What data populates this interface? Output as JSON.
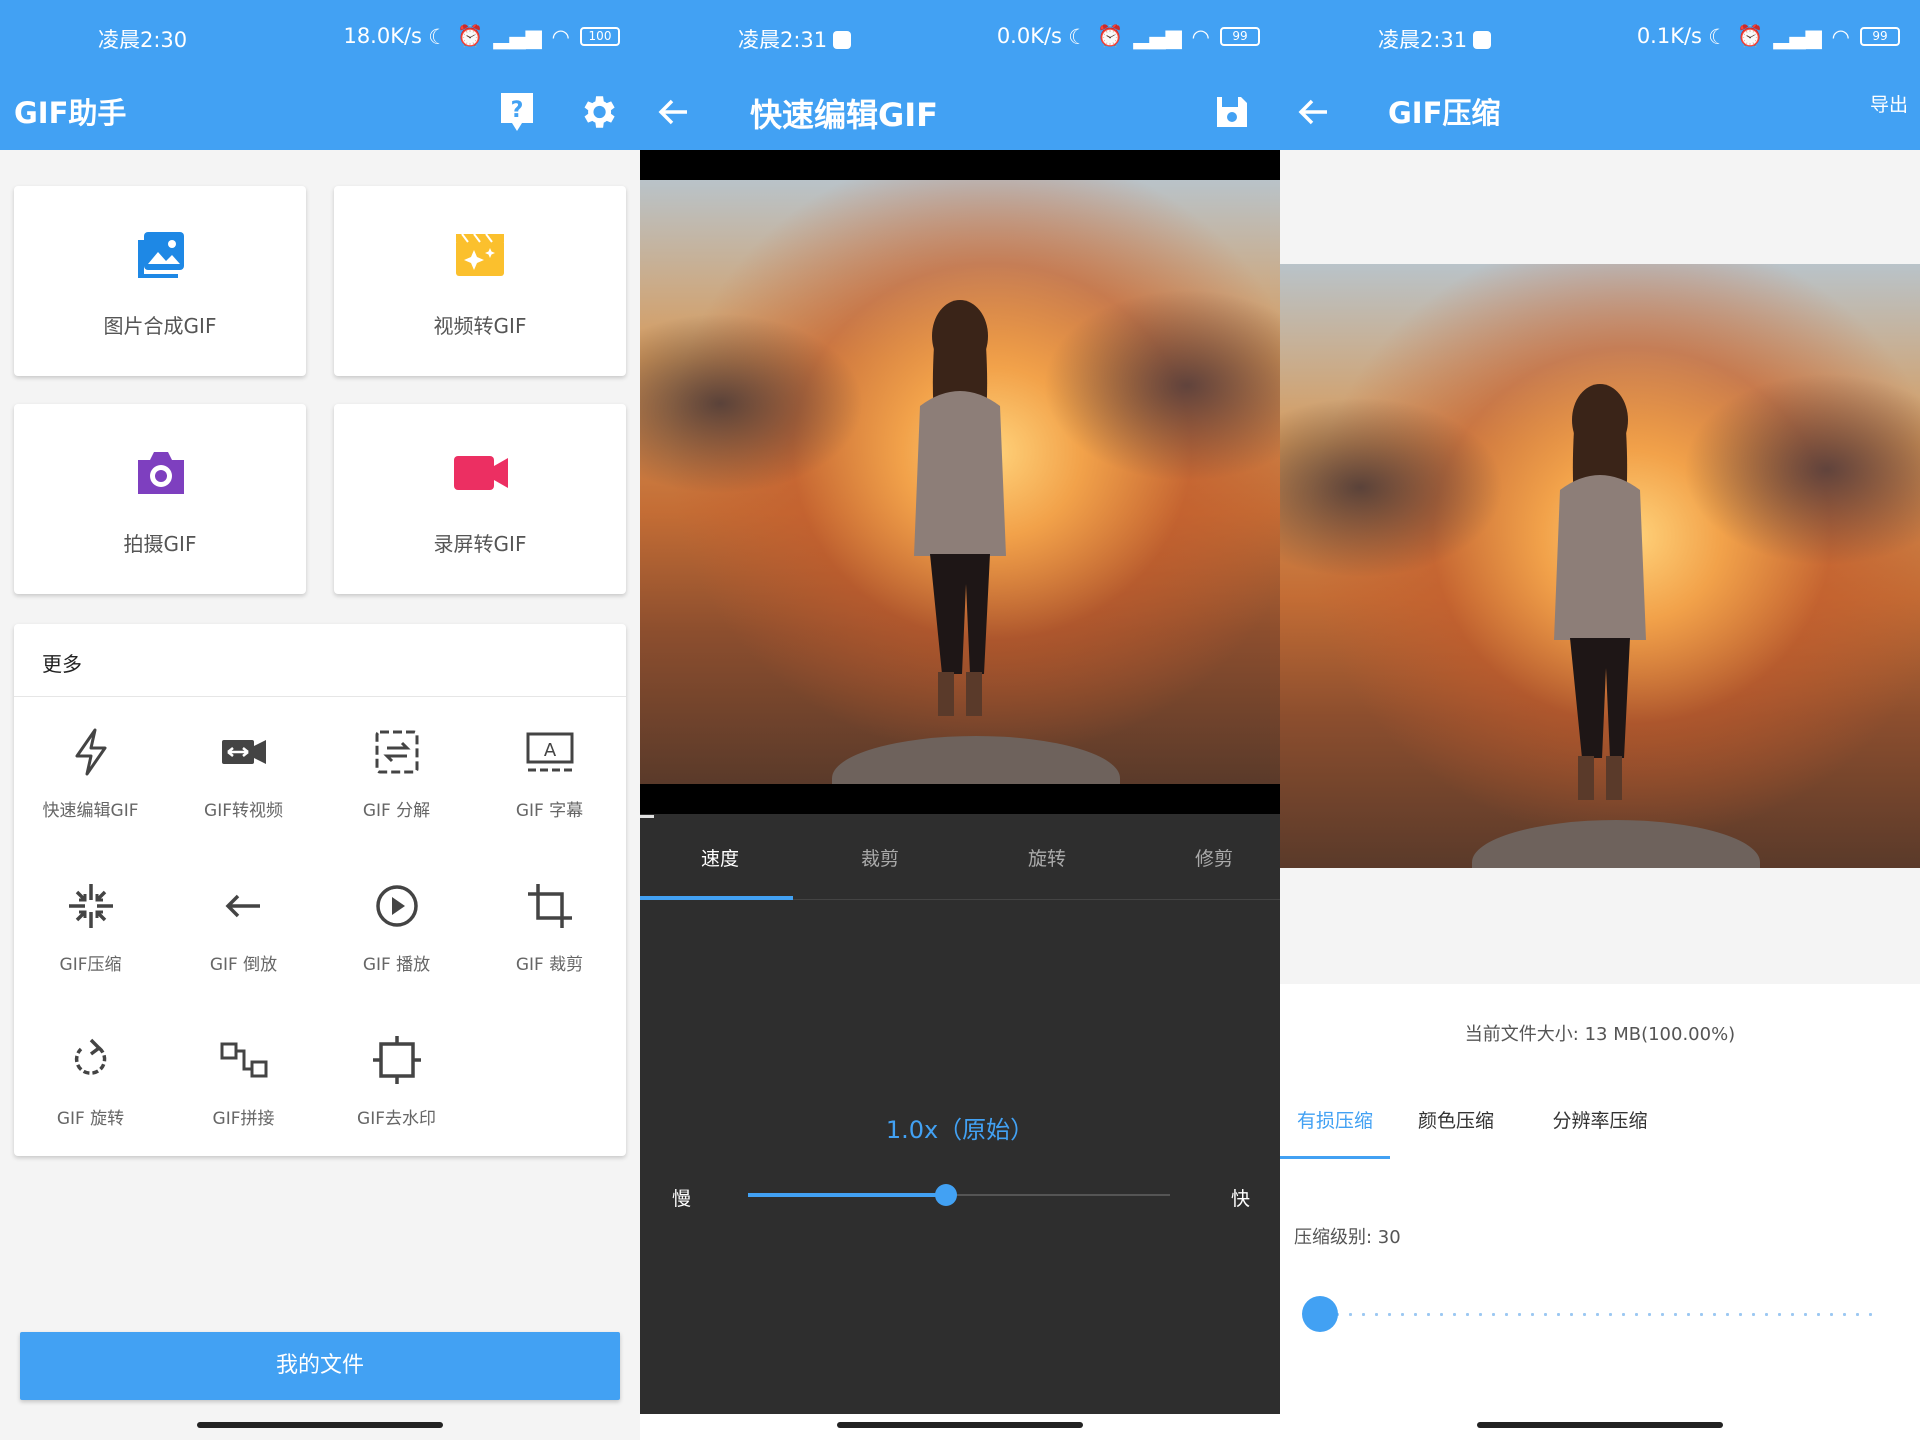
{
  "colors": {
    "primary": "#42a1f3",
    "dark_bg": "#2e2e2e",
    "light_bg": "#f4f4f4"
  },
  "screen1": {
    "status": {
      "time": "凌晨2:30",
      "speed": "18.0K/s",
      "battery": "100"
    },
    "title": "GIF助手",
    "icons": [
      "help-icon",
      "settings-gear-icon"
    ],
    "main_cards": [
      {
        "label": "图片合成GIF",
        "icon": "image-gallery-icon",
        "color": "#1e88e5"
      },
      {
        "label": "视频转GIF",
        "icon": "video-sparkle-icon",
        "color": "#fbc02d"
      },
      {
        "label": "拍摄GIF",
        "icon": "camera-icon",
        "color": "#7e3fbf"
      },
      {
        "label": "录屏转GIF",
        "icon": "video-camera-icon",
        "color": "#ec2f62"
      }
    ],
    "more_title": "更多",
    "tools": [
      {
        "label": "快速编辑GIF",
        "icon": "lightning-icon"
      },
      {
        "label": "GIF转视频",
        "icon": "video-convert-icon"
      },
      {
        "label": "GIF 分解",
        "icon": "split-icon"
      },
      {
        "label": "GIF 字幕",
        "icon": "subtitle-icon"
      },
      {
        "label": "GIF压缩",
        "icon": "compress-icon"
      },
      {
        "label": "GIF 倒放",
        "icon": "arrow-left-icon"
      },
      {
        "label": "GIF 播放",
        "icon": "play-icon"
      },
      {
        "label": "GIF 裁剪",
        "icon": "crop-icon"
      },
      {
        "label": "GIF 旋转",
        "icon": "rotate-icon"
      },
      {
        "label": "GIF拼接",
        "icon": "join-icon"
      },
      {
        "label": "GIF去水印",
        "icon": "remove-watermark-icon"
      }
    ],
    "bottom_button": "我的文件"
  },
  "screen2": {
    "status": {
      "time": "凌晨2:31",
      "speed": "0.0K/s",
      "battery": "99"
    },
    "title": "快速编辑GIF",
    "tabs": [
      "速度",
      "裁剪",
      "旋转",
      "修剪"
    ],
    "active_tab": 0,
    "speed_value": "1.0x（原始）",
    "slow_label": "慢",
    "fast_label": "快",
    "slider_fraction": 0.47
  },
  "screen3": {
    "status": {
      "time": "凌晨2:31",
      "speed": "0.1K/s",
      "battery": "99"
    },
    "title": "GIF压缩",
    "export_label": "导出",
    "file_size": "当前文件大小: 13 MB(100.00%)",
    "tabs": [
      "有损压缩",
      "颜色压缩",
      "分辨率压缩"
    ],
    "active_tab": 0,
    "level_label": "压缩级别: 30",
    "slider_fraction": 0.0
  }
}
